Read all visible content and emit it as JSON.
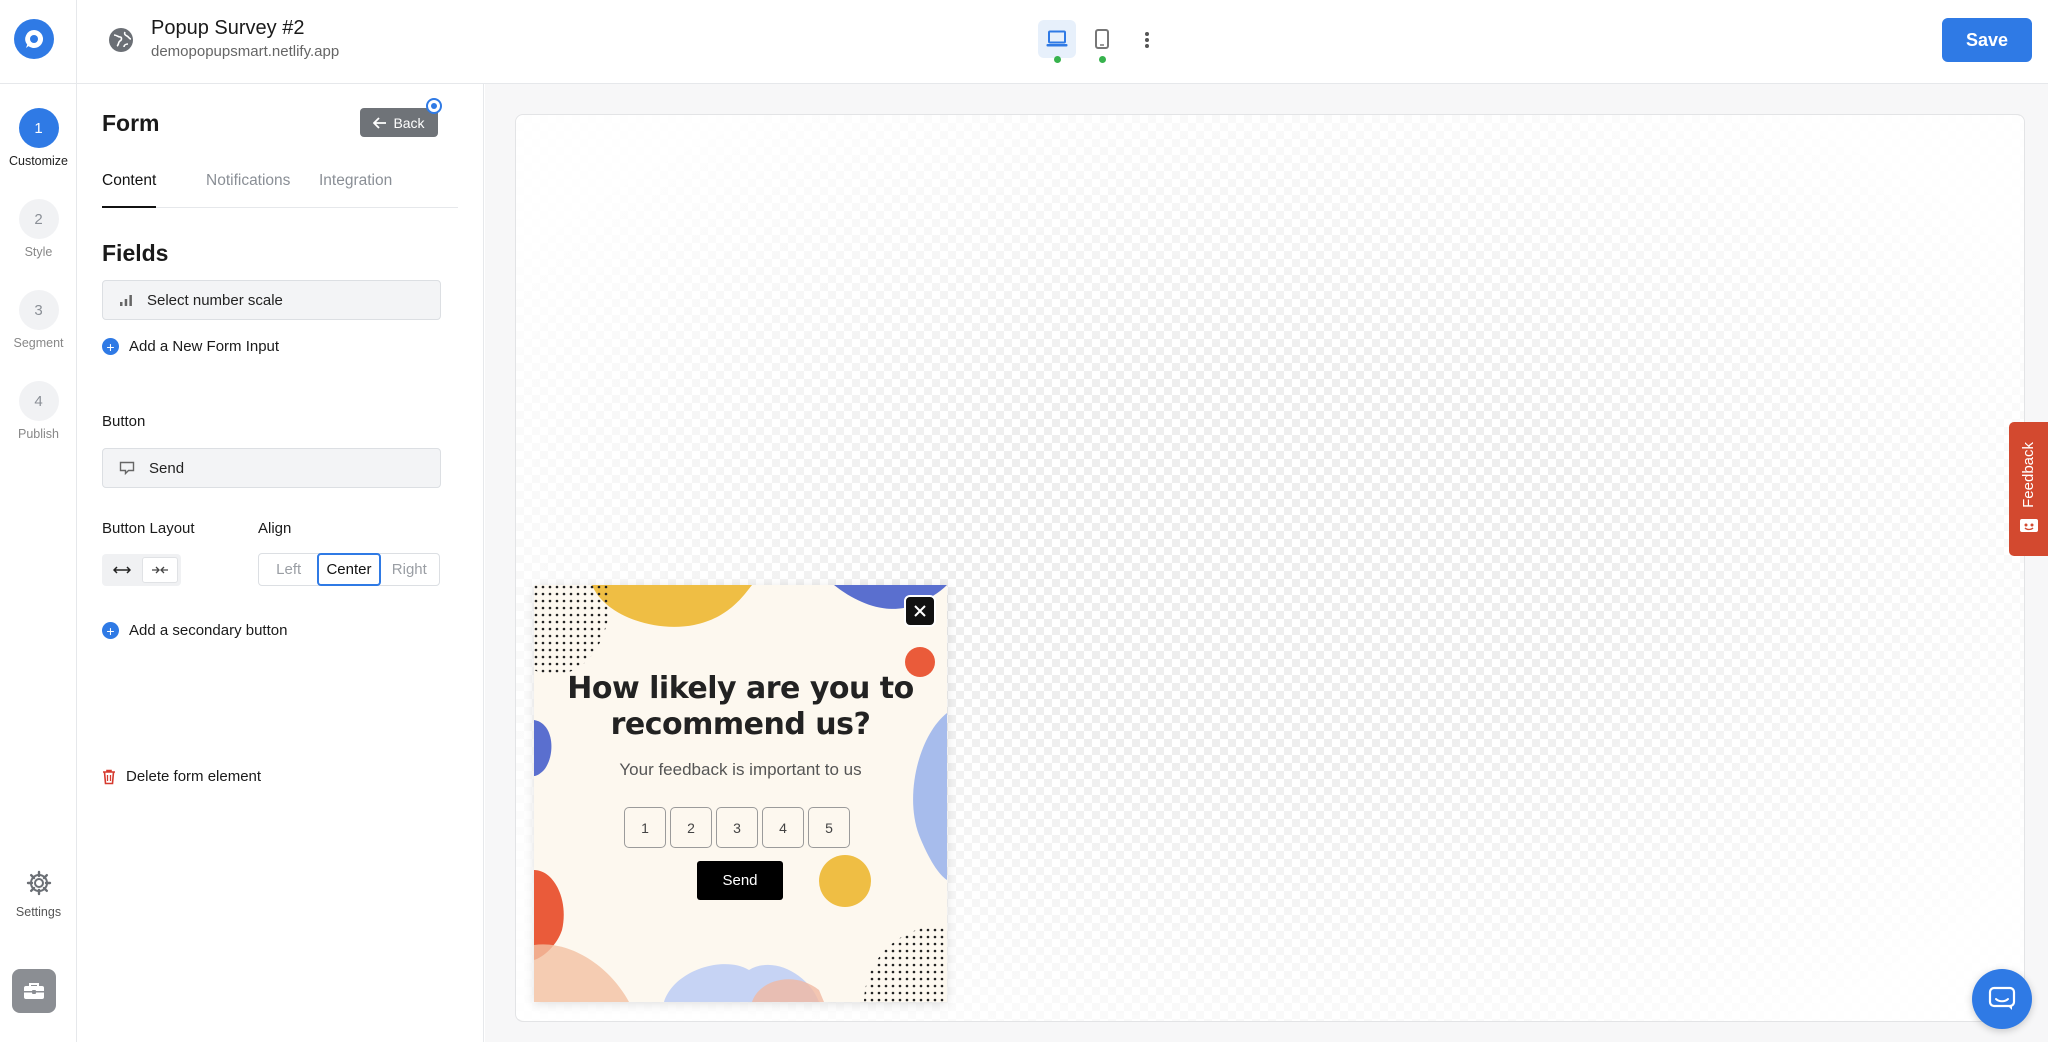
{
  "header": {
    "title": "Popup Survey #2",
    "url": "demopopupsmart.netlify.app",
    "save_label": "Save"
  },
  "steps": [
    {
      "number": "1",
      "label": "Customize",
      "active": true
    },
    {
      "number": "2",
      "label": "Style",
      "active": false
    },
    {
      "number": "3",
      "label": "Segment",
      "active": false
    },
    {
      "number": "4",
      "label": "Publish",
      "active": false
    }
  ],
  "rail": {
    "settings_label": "Settings"
  },
  "panel": {
    "title": "Form",
    "back_label": "Back",
    "tabs": [
      {
        "label": "Content",
        "active": true
      },
      {
        "label": "Notifications",
        "active": false
      },
      {
        "label": "Integration",
        "active": false
      }
    ],
    "fields_title": "Fields",
    "field_item": "Select number scale",
    "add_input_label": "Add a New Form Input",
    "button_section_label": "Button",
    "button_item": "Send",
    "button_layout_label": "Button Layout",
    "align_label": "Align",
    "align_options": [
      "Left",
      "Center",
      "Right"
    ],
    "align_selected": "Center",
    "add_secondary_label": "Add a secondary button",
    "delete_label": "Delete form element"
  },
  "popup": {
    "title_line1": "How likely are you to",
    "title_line2": "recommend us?",
    "subtitle": "Your feedback is important to us",
    "scale": [
      "1",
      "2",
      "3",
      "4",
      "5"
    ],
    "send_label": "Send"
  },
  "feedback_tab_label": "Feedback",
  "colors": {
    "accent": "#2f7ae5",
    "feedback": "#d3492f",
    "popup_bg": "#fdf8ef",
    "blob_yellow": "#efbe44",
    "blob_blue": "#a7bcec",
    "blob_orange": "#ea5b3a"
  }
}
